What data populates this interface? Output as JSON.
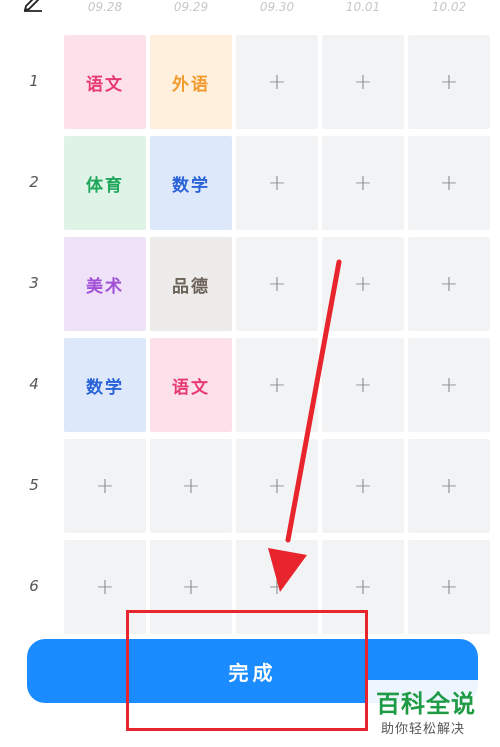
{
  "edit_icon": "pencil-edit-icon",
  "dates": [
    "09.28",
    "09.29",
    "09.30",
    "10.01",
    "10.02"
  ],
  "rows": [
    {
      "num": "1",
      "cells": [
        {
          "text": "语文",
          "bg": "#fde1ea",
          "color": "#e83a72"
        },
        {
          "text": "外语",
          "bg": "#fff0de",
          "color": "#f39a2c"
        },
        {
          "text": "+"
        },
        {
          "text": "+"
        },
        {
          "text": "+"
        }
      ]
    },
    {
      "num": "2",
      "cells": [
        {
          "text": "体育",
          "bg": "#dff4e7",
          "color": "#1ea75a"
        },
        {
          "text": "数学",
          "bg": "#dde8fb",
          "color": "#2a62d8"
        },
        {
          "text": "+"
        },
        {
          "text": "+"
        },
        {
          "text": "+"
        }
      ]
    },
    {
      "num": "3",
      "cells": [
        {
          "text": "美术",
          "bg": "#efe2f8",
          "color": "#a14fd6"
        },
        {
          "text": "品德",
          "bg": "#eeecea",
          "color": "#6b6258"
        },
        {
          "text": "+"
        },
        {
          "text": "+"
        },
        {
          "text": "+"
        }
      ]
    },
    {
      "num": "4",
      "cells": [
        {
          "text": "数学",
          "bg": "#dde8fb",
          "color": "#2a62d8"
        },
        {
          "text": "语文",
          "bg": "#fde1ea",
          "color": "#e83a72"
        },
        {
          "text": "+"
        },
        {
          "text": "+"
        },
        {
          "text": "+"
        }
      ]
    },
    {
      "num": "5",
      "cells": [
        {
          "text": "+"
        },
        {
          "text": "+"
        },
        {
          "text": "+"
        },
        {
          "text": "+"
        },
        {
          "text": "+"
        }
      ]
    },
    {
      "num": "6",
      "cells": [
        {
          "text": "+"
        },
        {
          "text": "+"
        },
        {
          "text": "+"
        },
        {
          "text": "+"
        },
        {
          "text": "+"
        }
      ]
    }
  ],
  "done_button": {
    "label": "完成",
    "color": "#1a8cff"
  },
  "annotation": {
    "arrow_color": "#e8252c",
    "box_color": "#e8252c"
  },
  "watermark": {
    "title": "百科全说",
    "subtitle": "助你轻松解决"
  }
}
